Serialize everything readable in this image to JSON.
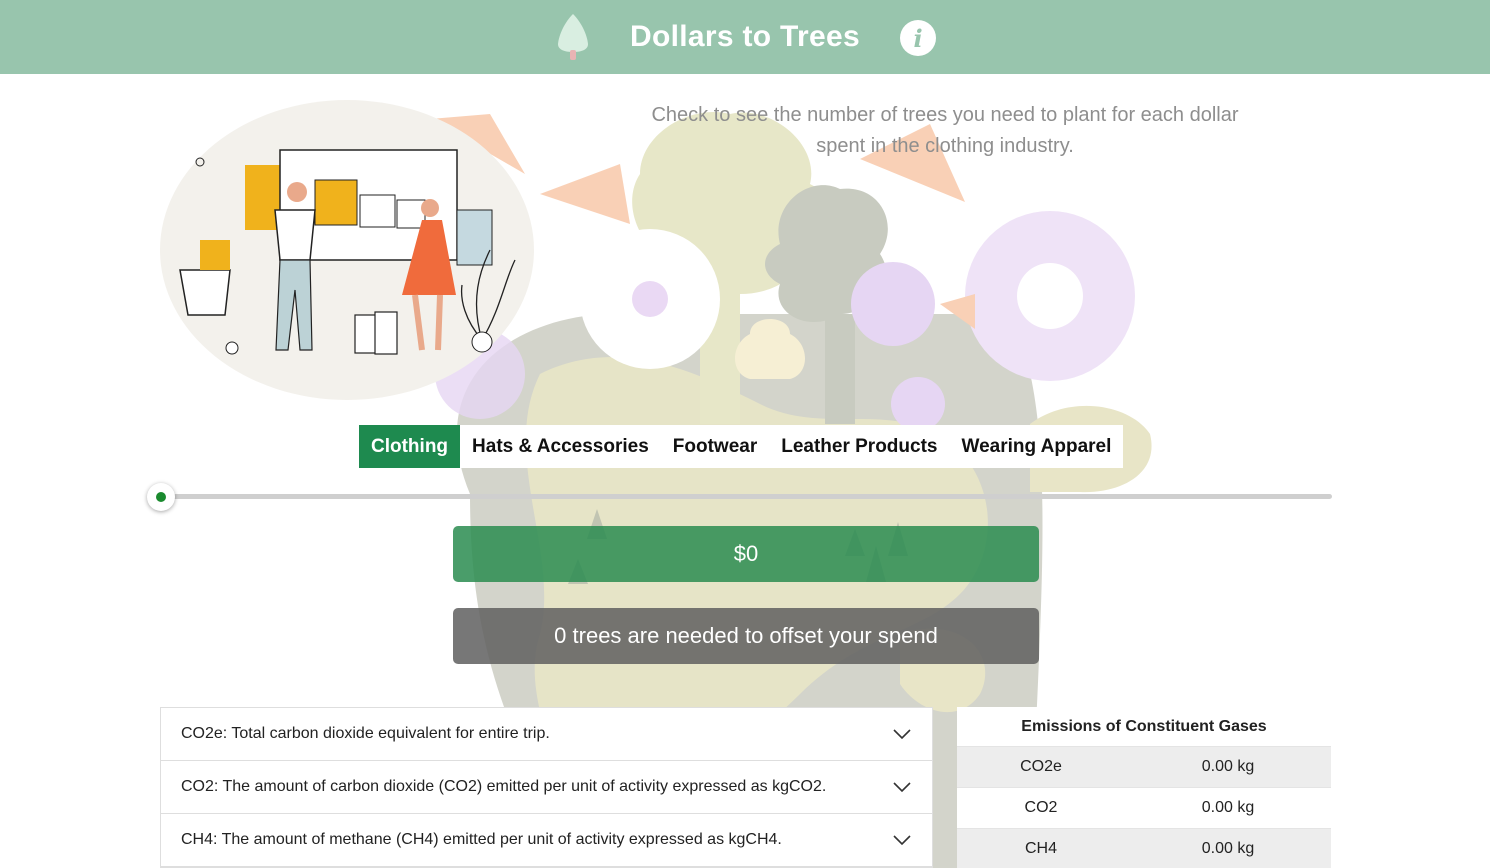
{
  "header": {
    "title": "Dollars to Trees",
    "logo_icon": "tree-icon",
    "info_icon": "info-icon",
    "info_glyph": "i"
  },
  "hero": {
    "subtitle": "Check to see the number of trees you need to plant for each dollar spent in the clothing industry."
  },
  "tabs": [
    {
      "label": "Clothing",
      "active": true
    },
    {
      "label": "Hats & Accessories",
      "active": false
    },
    {
      "label": "Footwear",
      "active": false
    },
    {
      "label": "Leather Products",
      "active": false
    },
    {
      "label": "Wearing Apparel",
      "active": false
    }
  ],
  "slider": {
    "value": 0
  },
  "amount": {
    "display": "$0"
  },
  "result": {
    "text": "0 trees are needed to offset your spend"
  },
  "accordion": [
    {
      "label": "CO2e: Total carbon dioxide equivalent for entire trip."
    },
    {
      "label": "CO2: The amount of carbon dioxide (CO2) emitted per unit of activity expressed as kgCO2."
    },
    {
      "label": "CH4: The amount of methane (CH4) emitted per unit of activity expressed as kgCH4."
    }
  ],
  "emissions": {
    "title": "Emissions of Constituent Gases",
    "rows": [
      {
        "gas": "CO2e",
        "value": "0.00 kg"
      },
      {
        "gas": "CO2",
        "value": "0.00 kg"
      },
      {
        "gas": "CH4",
        "value": "0.00 kg"
      }
    ]
  },
  "colors": {
    "header_bg": "#98c5ad",
    "active_tab": "#1e8a4f",
    "amount_bg": "#2a8c50",
    "result_bg": "#5f5f5f"
  }
}
